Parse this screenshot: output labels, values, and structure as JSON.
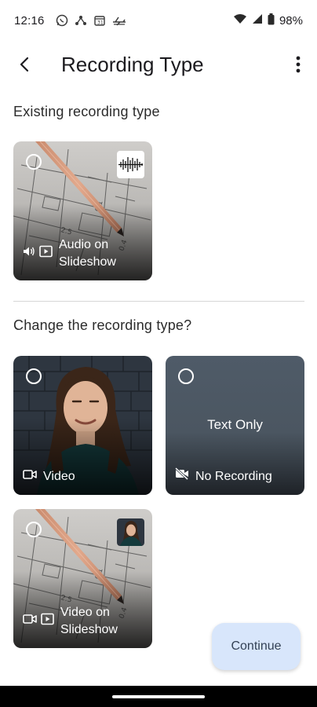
{
  "status_bar": {
    "time": "12:16",
    "battery": "98%",
    "left_icons": [
      "whatsapp-icon",
      "fork-icon",
      "calendar-icon",
      "plane-icon"
    ],
    "right_icons": [
      "wifi-icon",
      "signal-icon",
      "battery-icon"
    ]
  },
  "app_bar": {
    "title": "Recording Type",
    "back_icon": "arrow-back-icon",
    "menu_icon": "more-vert-icon"
  },
  "sections": {
    "existing_heading": "Existing recording type",
    "change_heading": "Change the recording type?"
  },
  "existing_card": {
    "label": "Audio on Slideshow",
    "selected": false,
    "icons": [
      "speaker-icon",
      "slideshow-icon"
    ],
    "badge": "waveform-icon"
  },
  "options": {
    "video": {
      "label": "Video",
      "selected": false,
      "icon": "videocam-icon"
    },
    "no_recording": {
      "label": "No Recording",
      "center_text": "Text Only",
      "selected": false,
      "icon": "videocam-off-icon"
    },
    "video_on_slideshow": {
      "label": "Video on Slideshow",
      "selected": false,
      "icons": [
        "videocam-icon",
        "slideshow-icon"
      ],
      "badge": "person-thumbnail"
    }
  },
  "continue_button": {
    "label": "Continue"
  },
  "colors": {
    "continue_bg": "#d8e6fb",
    "text_only_bg": "#4f5b68",
    "divider": "#d6d6d6"
  }
}
